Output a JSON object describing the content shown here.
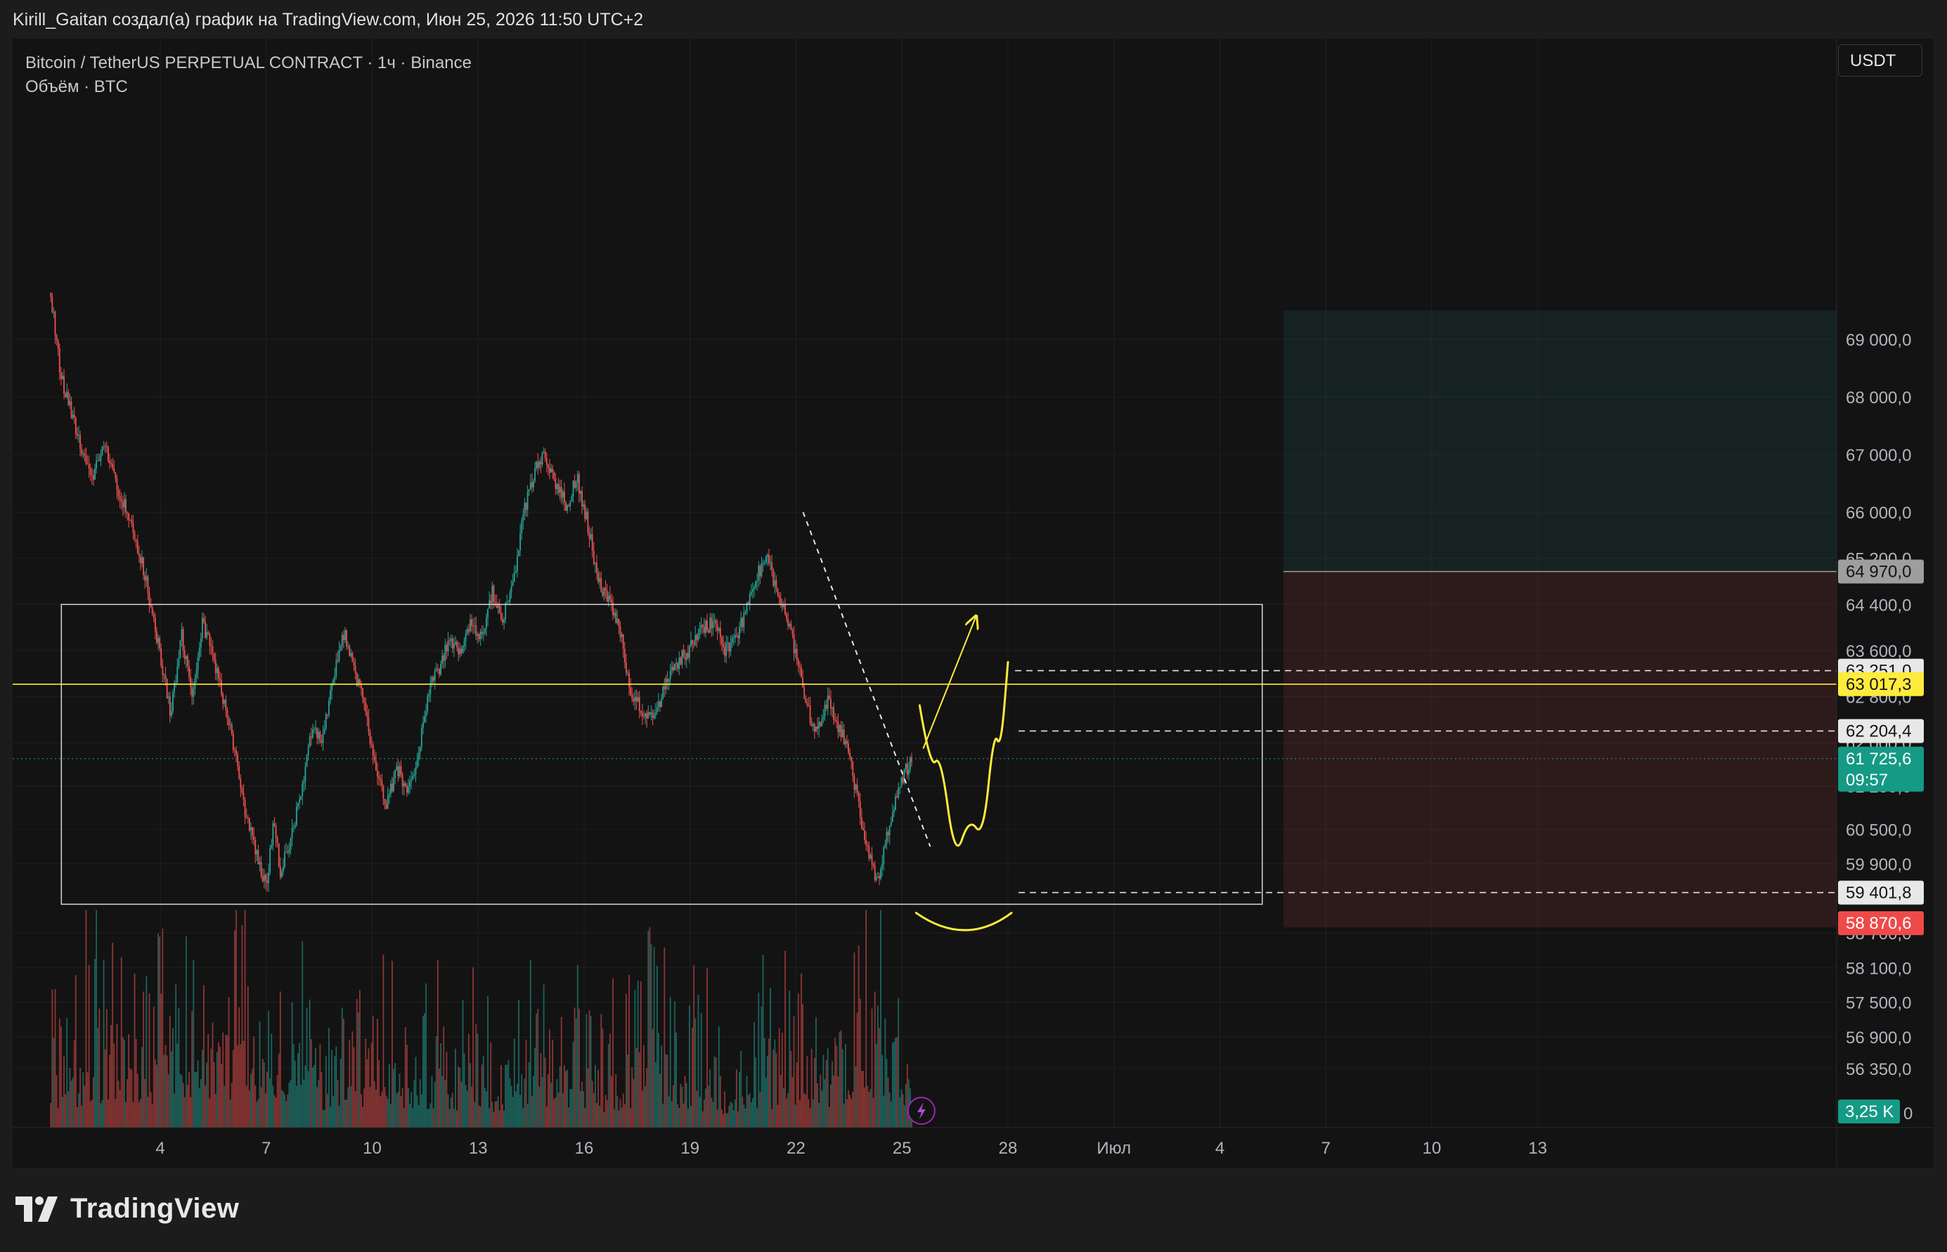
{
  "header": {
    "attribution": "Kirill_Gaitan создал(а) график на TradingView.com, Июн 25, 2026 11:50 UTC+2"
  },
  "legend": {
    "symbol": "Bitcoin / TetherUS PERPETUAL CONTRACT · 1ч · Binance",
    "volume": "Объём · BTC"
  },
  "currency": "USDT",
  "brand": "TradingView",
  "colors": {
    "up": "#26a69a",
    "down": "#ef5350",
    "yellow": "#ffeb3b",
    "white": "#ffffff",
    "grid": "#1f1f1f"
  },
  "chart_data": {
    "type": "candlestick",
    "timeframe": "1h",
    "y_ticks": [
      69000,
      68000,
      67000,
      66000,
      65200,
      64400,
      63600,
      62800,
      62000,
      61250,
      60500,
      59900,
      58700,
      58100,
      57500,
      56900,
      56350
    ],
    "y_tick_labels": [
      "69 000,0",
      "68 000,0",
      "67 000,0",
      "66 000,0",
      "65 200,0",
      "64 400,0",
      "63 600,0",
      "62 800,0",
      "62 000,0",
      "61 250,0",
      "60 500,0",
      "59 900,0",
      "58 700,0",
      "58 100,0",
      "57 500,0",
      "56 900,0",
      "56 350,0"
    ],
    "volume_zero_label": "0",
    "x_ticks": [
      {
        "label": "4",
        "day": 4
      },
      {
        "label": "7",
        "day": 7
      },
      {
        "label": "10",
        "day": 10
      },
      {
        "label": "13",
        "day": 13
      },
      {
        "label": "16",
        "day": 16
      },
      {
        "label": "19",
        "day": 19
      },
      {
        "label": "22",
        "day": 22
      },
      {
        "label": "25",
        "day": 25
      },
      {
        "label": "28",
        "day": 28
      },
      {
        "label": "Июл",
        "day": 31
      },
      {
        "label": "4",
        "day": 34
      },
      {
        "label": "7",
        "day": 37
      },
      {
        "label": "10",
        "day": 40
      },
      {
        "label": "13",
        "day": 43
      }
    ],
    "price_path": [
      [
        0.9,
        69800
      ],
      [
        1.2,
        68300
      ],
      [
        1.5,
        67700
      ],
      [
        1.8,
        67000
      ],
      [
        2.1,
        66600
      ],
      [
        2.4,
        67200
      ],
      [
        2.8,
        66400
      ],
      [
        3.2,
        65800
      ],
      [
        3.6,
        64800
      ],
      [
        4.0,
        63500
      ],
      [
        4.3,
        62500
      ],
      [
        4.6,
        63900
      ],
      [
        4.9,
        62800
      ],
      [
        5.2,
        64100
      ],
      [
        5.5,
        63500
      ],
      [
        5.8,
        62700
      ],
      [
        6.1,
        61900
      ],
      [
        6.4,
        60800
      ],
      [
        6.7,
        60100
      ],
      [
        7.0,
        59500
      ],
      [
        7.2,
        60600
      ],
      [
        7.4,
        59800
      ],
      [
        7.7,
        60300
      ],
      [
        8.0,
        61200
      ],
      [
        8.3,
        62300
      ],
      [
        8.6,
        62100
      ],
      [
        8.9,
        63100
      ],
      [
        9.2,
        63900
      ],
      [
        9.5,
        63200
      ],
      [
        9.8,
        62600
      ],
      [
        10.1,
        61500
      ],
      [
        10.4,
        60900
      ],
      [
        10.7,
        61600
      ],
      [
        11.0,
        61100
      ],
      [
        11.3,
        61800
      ],
      [
        11.6,
        62900
      ],
      [
        11.9,
        63300
      ],
      [
        12.2,
        63800
      ],
      [
        12.5,
        63600
      ],
      [
        12.8,
        64100
      ],
      [
        13.1,
        63800
      ],
      [
        13.4,
        64600
      ],
      [
        13.7,
        64200
      ],
      [
        14.0,
        64800
      ],
      [
        14.3,
        66000
      ],
      [
        14.6,
        66700
      ],
      [
        14.9,
        67000
      ],
      [
        15.2,
        66500
      ],
      [
        15.5,
        66100
      ],
      [
        15.8,
        66600
      ],
      [
        16.1,
        65800
      ],
      [
        16.4,
        64800
      ],
      [
        16.7,
        64500
      ],
      [
        17.0,
        64000
      ],
      [
        17.3,
        62900
      ],
      [
        17.6,
        62600
      ],
      [
        17.9,
        62400
      ],
      [
        18.2,
        62800
      ],
      [
        18.5,
        63300
      ],
      [
        18.8,
        63500
      ],
      [
        19.1,
        63700
      ],
      [
        19.4,
        64000
      ],
      [
        19.7,
        64100
      ],
      [
        20.0,
        63600
      ],
      [
        20.3,
        63800
      ],
      [
        20.6,
        64300
      ],
      [
        20.9,
        64900
      ],
      [
        21.2,
        65300
      ],
      [
        21.4,
        64700
      ],
      [
        21.7,
        64300
      ],
      [
        22.0,
        63500
      ],
      [
        22.3,
        62600
      ],
      [
        22.6,
        62200
      ],
      [
        22.9,
        62800
      ],
      [
        23.2,
        62300
      ],
      [
        23.5,
        61800
      ],
      [
        23.8,
        60800
      ],
      [
        24.1,
        60000
      ],
      [
        24.3,
        59500
      ],
      [
        24.5,
        60200
      ],
      [
        24.8,
        61000
      ],
      [
        25.1,
        61500
      ],
      [
        25.3,
        61726
      ]
    ],
    "volume_profile": [
      [
        0.9,
        0.4
      ],
      [
        2,
        0.7
      ],
      [
        3.5,
        0.5
      ],
      [
        4,
        0.9
      ],
      [
        5.5,
        0.6
      ],
      [
        6.4,
        1.0
      ],
      [
        6.6,
        0.8
      ],
      [
        7,
        0.7
      ],
      [
        8,
        0.6
      ],
      [
        9,
        0.4
      ],
      [
        10,
        0.7
      ],
      [
        11,
        0.5
      ],
      [
        12,
        0.45
      ],
      [
        13,
        0.55
      ],
      [
        14,
        0.4
      ],
      [
        15,
        0.6
      ],
      [
        16,
        0.5
      ],
      [
        17,
        0.45
      ],
      [
        18,
        0.8
      ],
      [
        19,
        0.5
      ],
      [
        20,
        0.4
      ],
      [
        21,
        0.55
      ],
      [
        22,
        0.6
      ],
      [
        23,
        0.5
      ],
      [
        24,
        0.9
      ],
      [
        24.5,
        0.85
      ],
      [
        25,
        0.5
      ],
      [
        25.3,
        0.2
      ]
    ],
    "price_labels": [
      {
        "price": 64970,
        "text": "64 970,0",
        "bg": "#9e9e9e",
        "fg": "#131313"
      },
      {
        "price": 63251,
        "text": "63 251,0",
        "bg": "#e8e8e8",
        "fg": "#131313"
      },
      {
        "price": 63017.3,
        "text": "63 017,3",
        "bg": "#ffeb3b",
        "fg": "#131313"
      },
      {
        "price": 62204.4,
        "text": "62 204,4",
        "bg": "#e8e8e8",
        "fg": "#131313"
      },
      {
        "price": 61725.6,
        "text": "61 725,6",
        "time": "09:57",
        "bg": "#159a85",
        "fg": "#ffffff"
      },
      {
        "price": 59401.8,
        "text": "59 401,8",
        "bg": "#e8e8e8",
        "fg": "#131313"
      },
      {
        "price": 58870.6,
        "text": "58 870,6",
        "bg": "#ef4a4a",
        "fg": "#ffffff"
      }
    ],
    "volume_label": {
      "text": "3,25 K",
      "bg": "#159a85",
      "fg": "#ffffff"
    },
    "annotations": {
      "range_box": {
        "day_start": 1.2,
        "day_end": 35.2,
        "price_top": 64400,
        "price_bottom": 59200
      },
      "horizontal_line": 63017.3,
      "current_price": 61725.6,
      "trendline": {
        "from": [
          22.2,
          66000
        ],
        "to": [
          25.8,
          60200
        ]
      },
      "position": {
        "day_start": 35.8,
        "entry": 64970,
        "target_top": 69500,
        "stop": 58800
      },
      "dashed_levels": [
        {
          "day_start": 28.2,
          "price": 63251
        },
        {
          "day_start": 28.3,
          "price": 62204.4
        },
        {
          "day_start": 28.3,
          "price": 59401.8
        }
      ],
      "projection_arrow": {
        "from": [
          25.6,
          61900
        ],
        "to": [
          27.1,
          64200
        ]
      },
      "projection_wave": [
        [
          25.5,
          62650
        ],
        [
          25.8,
          61550
        ],
        [
          26.1,
          61800
        ],
        [
          26.5,
          59950
        ],
        [
          26.9,
          60700
        ],
        [
          27.3,
          60350
        ],
        [
          27.6,
          62200
        ],
        [
          27.8,
          61900
        ],
        [
          28.0,
          63400
        ]
      ],
      "arc": {
        "from": [
          25.4,
          59050
        ],
        "mid": [
          26.8,
          58750
        ],
        "to": [
          28.1,
          59050
        ]
      }
    }
  }
}
